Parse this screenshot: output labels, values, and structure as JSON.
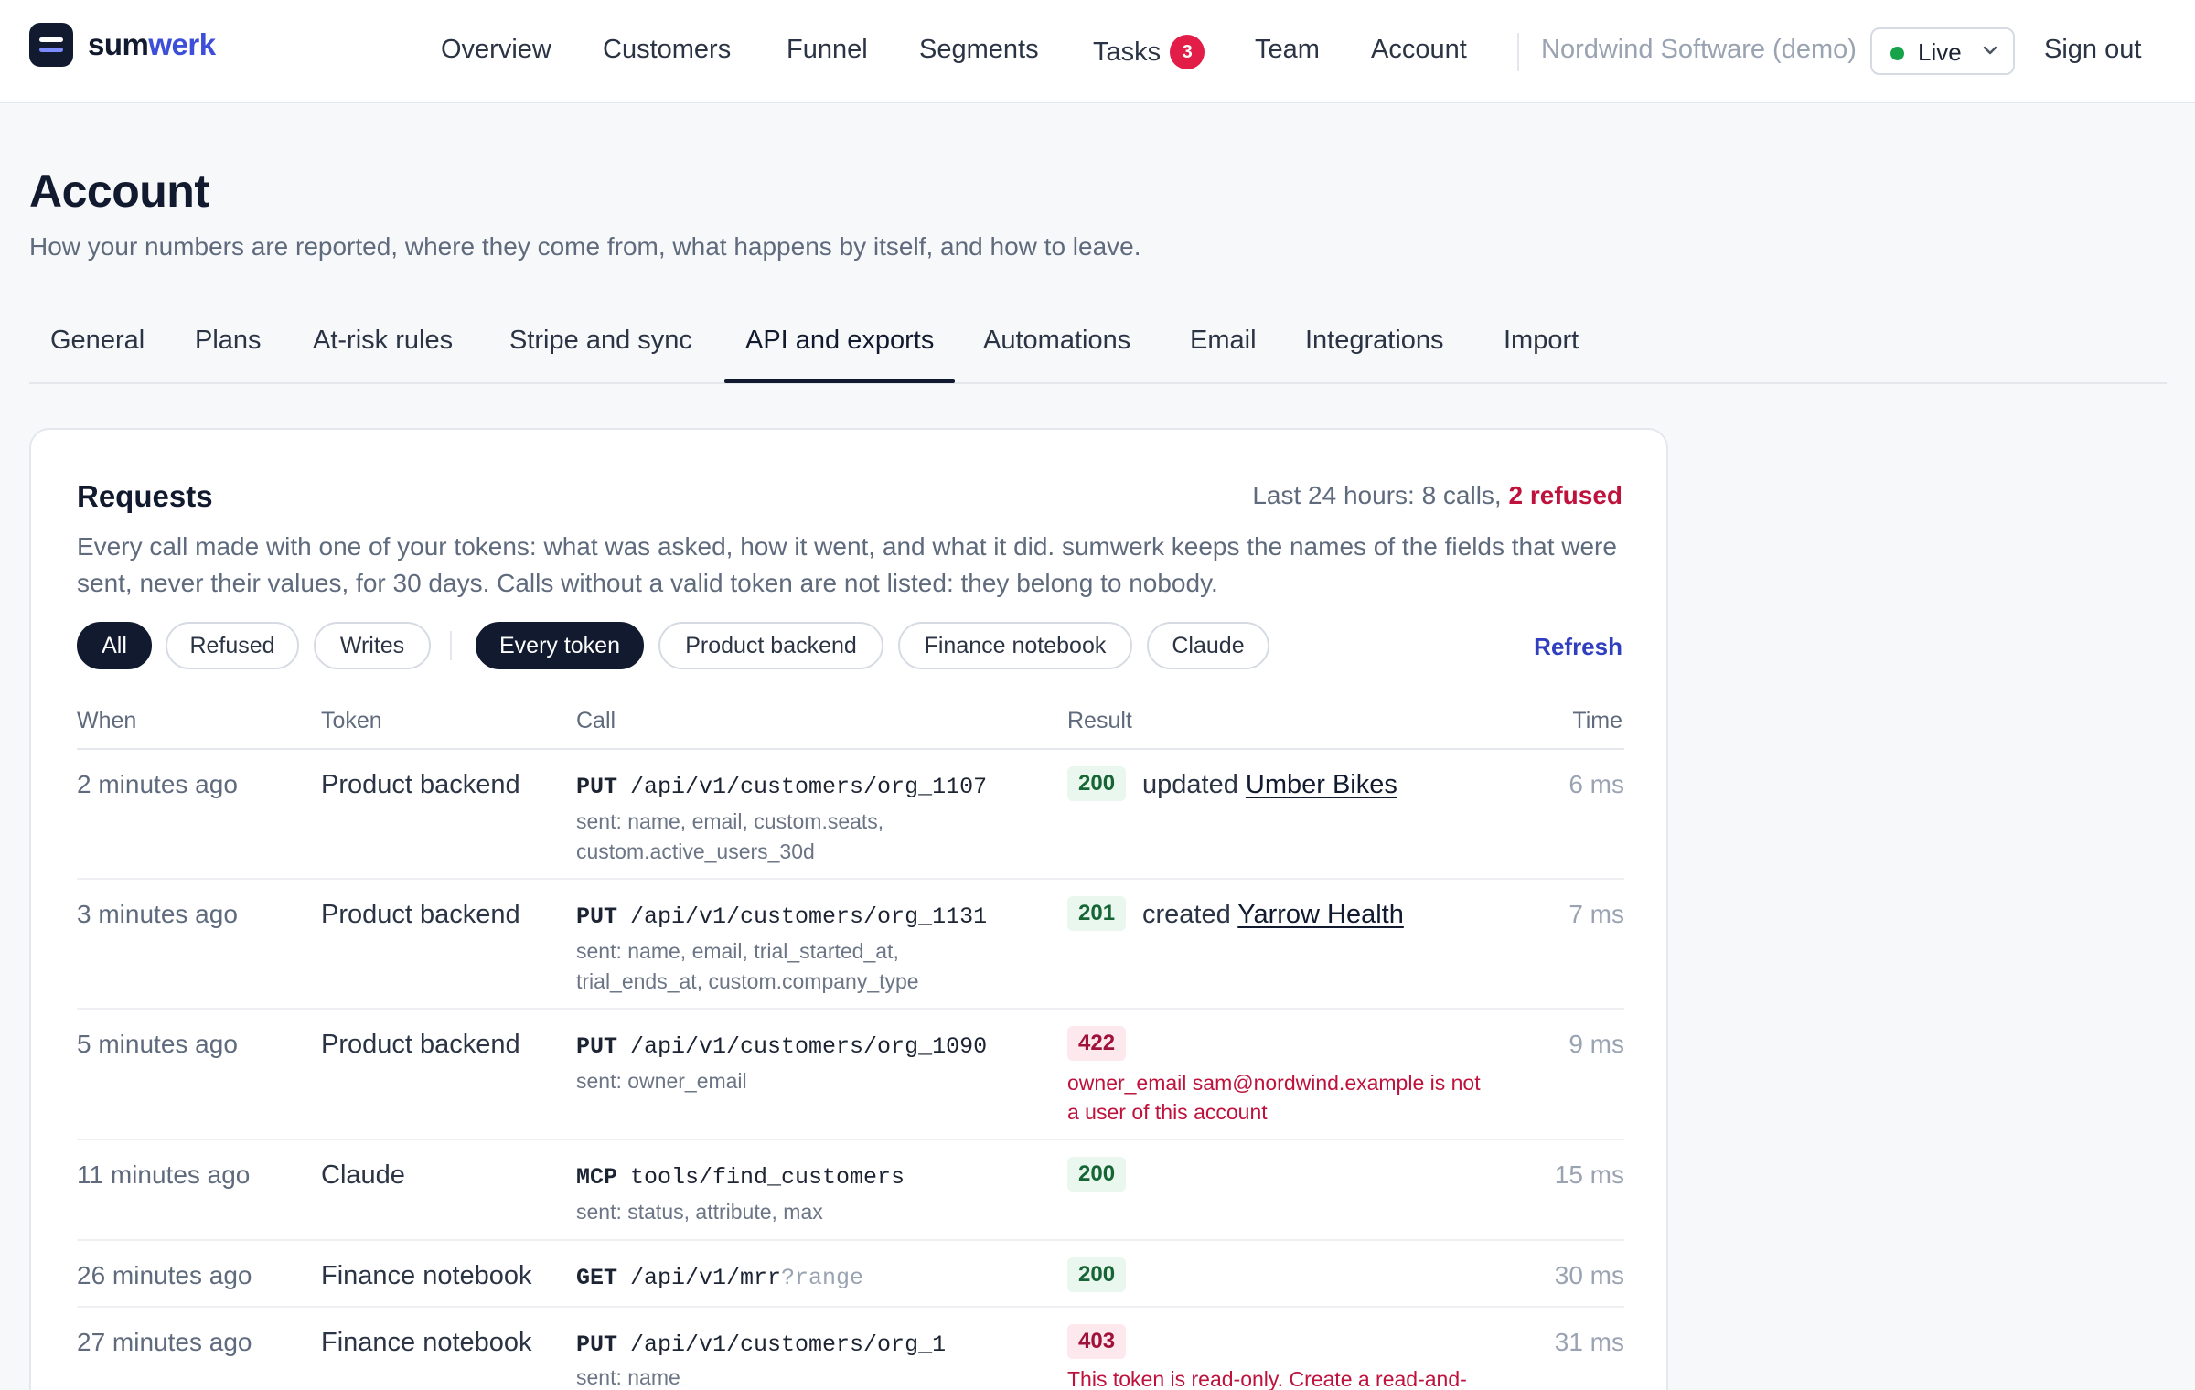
{
  "brand": {
    "part1": "sum",
    "part2": "werk"
  },
  "nav": {
    "items": [
      "Overview",
      "Customers",
      "Funnel",
      "Segments",
      "Tasks",
      "Team",
      "Account"
    ],
    "tasks_count": "3",
    "org": "Nordwind Software (demo)",
    "env": "Live",
    "sign_out": "Sign out"
  },
  "page": {
    "title": "Account",
    "subtitle": "How your numbers are reported, where they come from, what happens by itself, and how to leave."
  },
  "tabs": [
    "General",
    "Plans",
    "At-risk rules",
    "Stripe and sync",
    "API and exports",
    "Automations",
    "Email",
    "Integrations",
    "Import"
  ],
  "active_tab": "API and exports",
  "requests": {
    "title": "Requests",
    "summary_prefix": "Last 24 hours: 8 calls, ",
    "summary_refused": "2 refused",
    "description": "Every call made with one of your tokens: what was asked, how it went, and what it did. sumwerk keeps the names of the fields that were sent, never their values, for 30 days. Calls without a valid token are not listed: they belong to nobody.",
    "filters": [
      "All",
      "Refused",
      "Writes"
    ],
    "active_filter": "All",
    "token_filters": [
      "Every token",
      "Product backend",
      "Finance notebook",
      "Claude"
    ],
    "active_token_filter": "Every token",
    "refresh": "Refresh",
    "columns": [
      "When",
      "Token",
      "Call",
      "Result",
      "Time"
    ],
    "rows": [
      {
        "when": "2 minutes ago",
        "token": "Product backend",
        "method": "PUT",
        "path": "/api/v1/customers/org_1107",
        "query": "",
        "sent": "sent: name, email, custom.seats, custom.active_users_30d",
        "status": "200",
        "result_prefix": "updated ",
        "result_link": "Umber Bikes",
        "error": "",
        "time": "6 ms"
      },
      {
        "when": "3 minutes ago",
        "token": "Product backend",
        "method": "PUT",
        "path": "/api/v1/customers/org_1131",
        "query": "",
        "sent": "sent: name, email, trial_started_at, trial_ends_at, custom.company_type",
        "status": "201",
        "result_prefix": "created ",
        "result_link": "Yarrow Health",
        "error": "",
        "time": "7 ms"
      },
      {
        "when": "5 minutes ago",
        "token": "Product backend",
        "method": "PUT",
        "path": "/api/v1/customers/org_1090",
        "query": "",
        "sent": "sent: owner_email",
        "status": "422",
        "result_prefix": "",
        "result_link": "",
        "error": "owner_email sam@nordwind.example is not a user of this account",
        "time": "9 ms"
      },
      {
        "when": "11 minutes ago",
        "token": "Claude",
        "method": "MCP",
        "path": "tools/find_customers",
        "query": "",
        "sent": "sent: status, attribute, max",
        "status": "200",
        "result_prefix": "",
        "result_link": "",
        "error": "",
        "time": "15 ms"
      },
      {
        "when": "26 minutes ago",
        "token": "Finance notebook",
        "method": "GET",
        "path": "/api/v1/mrr",
        "query": "?range",
        "sent": "",
        "status": "200",
        "result_prefix": "",
        "result_link": "",
        "error": "",
        "time": "30 ms"
      },
      {
        "when": "27 minutes ago",
        "token": "Finance notebook",
        "method": "PUT",
        "path": "/api/v1/customers/org_1",
        "query": "",
        "sent": "sent: name",
        "status": "403",
        "result_prefix": "",
        "result_link": "",
        "error": "This token is read-only. Create a read-and-",
        "time": "31 ms"
      }
    ]
  },
  "colors": {
    "accent": "#3d4fd8",
    "ink": "#111a2e",
    "danger": "#be123c",
    "ok": "#166534",
    "live": "#16a34a"
  }
}
